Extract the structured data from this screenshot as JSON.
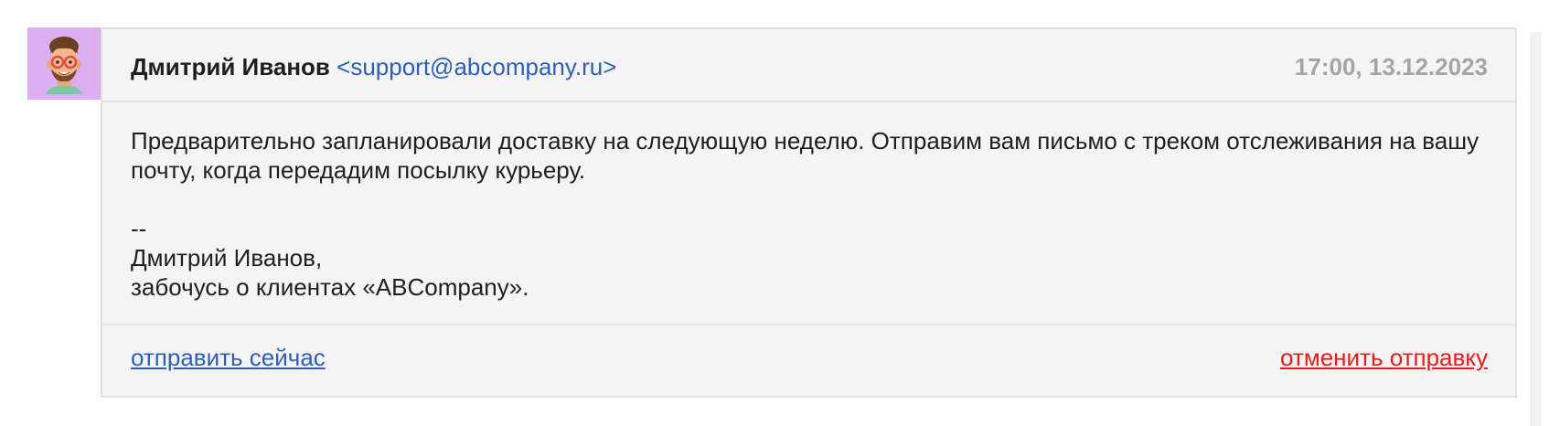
{
  "message": {
    "sender_name": "Дмитрий Иванов",
    "sender_email": "<support@abcompany.ru>",
    "timestamp": "17:00, 13.12.2023",
    "body": "Предварительно запланировали доставку на следующую неделю. Отправим вам письмо с треком отслеживания на вашу почту, когда передадим посылку курьеру.",
    "signature": {
      "separator": "--",
      "line1": "Дмитрий Иванов,",
      "line2": "забочусь о клиентах «ABCompany»."
    }
  },
  "actions": {
    "send_now": "отправить сейчас",
    "cancel_send": "отменить отправку"
  },
  "avatar": {
    "icon": "memoji-avatar-icon",
    "background": "#dcaff3"
  },
  "colors": {
    "link": "#2e5fb6",
    "cancel": "#ea1b1b",
    "timestamp": "#a5a5a5",
    "card_background": "#f4f4f4",
    "border": "#e1e1e1"
  }
}
